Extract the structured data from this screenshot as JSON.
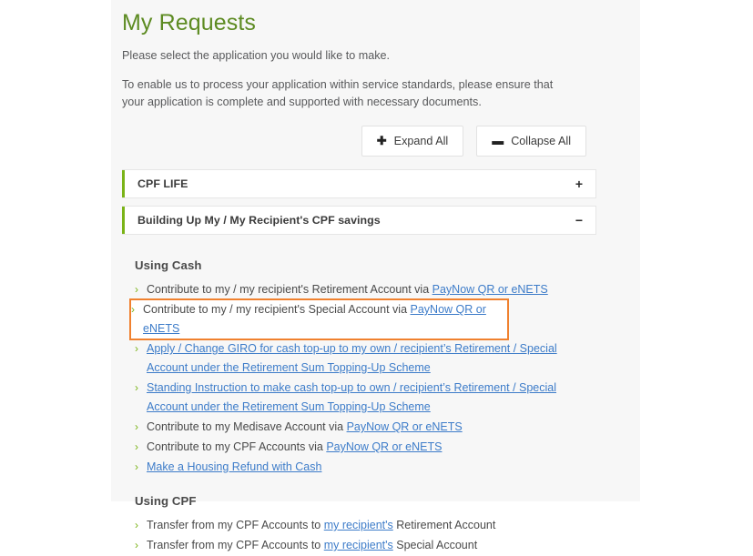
{
  "page": {
    "title": "My Requests",
    "intro_line_1": "Please select the application you would like to make.",
    "intro_line_2": "To enable us to process your application within service standards, please ensure that your application is complete and supported with necessary documents."
  },
  "toolbar": {
    "expand_all_label": "Expand All",
    "expand_all_symbol": "➕",
    "collapse_all_label": "Collapse All",
    "collapse_all_symbol": "➖"
  },
  "accordions": [
    {
      "label": "CPF LIFE",
      "toggle": "+",
      "expanded": false
    },
    {
      "label": "Building Up My / My Recipient's CPF savings",
      "toggle": "−",
      "expanded": true
    }
  ],
  "sections": [
    {
      "title": "Using Cash",
      "items": [
        {
          "chevron": "›",
          "parts": [
            {
              "text": "Contribute to my / my recipient's Retirement Account via ",
              "link": false
            },
            {
              "text": "PayNow QR or eNETS",
              "link": true
            }
          ],
          "highlighted": false
        },
        {
          "chevron": "›",
          "parts": [
            {
              "text": "Contribute to my / my recipient's Special Account via ",
              "link": false
            },
            {
              "text": "PayNow QR or eNETS",
              "link": true
            }
          ],
          "highlighted": true
        },
        {
          "chevron": "›",
          "parts": [
            {
              "text": "Apply / Change GIRO for cash top-up to my own / recipient’s Retirement / Special Account under the Retirement Sum Topping-Up Scheme",
              "link": true
            }
          ],
          "highlighted": false
        },
        {
          "chevron": "›",
          "parts": [
            {
              "text": "Standing Instruction to make cash top-up to own / recipient’s Retirement / Special Account under the Retirement Sum Topping-Up Scheme",
              "link": true
            }
          ],
          "highlighted": false
        },
        {
          "chevron": "›",
          "parts": [
            {
              "text": "Contribute to my Medisave Account via ",
              "link": false
            },
            {
              "text": "PayNow QR or eNETS",
              "link": true
            }
          ],
          "highlighted": false
        },
        {
          "chevron": "›",
          "parts": [
            {
              "text": "Contribute to my CPF Accounts via ",
              "link": false
            },
            {
              "text": "PayNow QR or eNETS",
              "link": true
            }
          ],
          "highlighted": false
        },
        {
          "chevron": "›",
          "parts": [
            {
              "text": "Make a Housing Refund with Cash",
              "link": true
            }
          ],
          "highlighted": false
        }
      ]
    },
    {
      "title": "Using CPF",
      "items": [
        {
          "chevron": "›",
          "parts": [
            {
              "text": "Transfer from my CPF Accounts to ",
              "link": false
            },
            {
              "text": "my recipient's",
              "link": true
            },
            {
              "text": " Retirement Account",
              "link": false
            }
          ],
          "highlighted": false
        },
        {
          "chevron": "›",
          "parts": [
            {
              "text": "Transfer from my CPF Accounts to ",
              "link": false
            },
            {
              "text": "my recipient's",
              "link": true
            },
            {
              "text": " Special Account",
              "link": false
            }
          ],
          "highlighted": false
        }
      ]
    }
  ],
  "colors": {
    "heading_green": "#5d8b22",
    "accent_green": "#7ab317",
    "link_blue": "#3d7cc9",
    "highlight_orange": "#f0812f",
    "panel_bg": "#f7f7f7",
    "text_grey": "#4a4a4a"
  }
}
